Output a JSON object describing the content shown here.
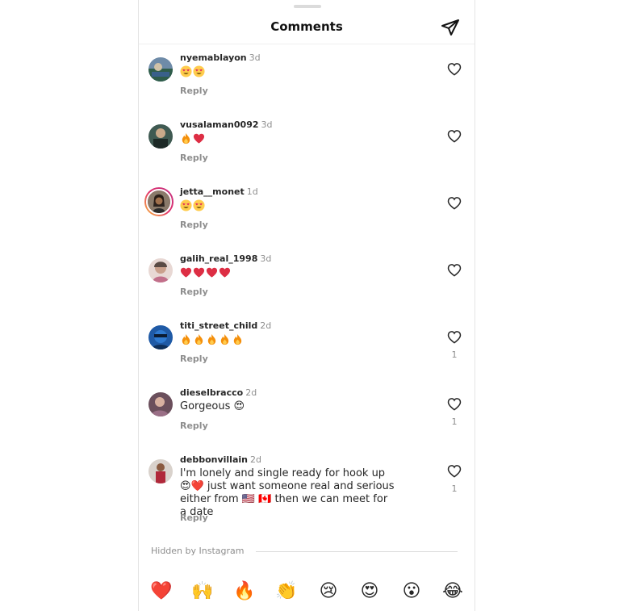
{
  "header": {
    "title": "Comments",
    "share_icon": "paper-plane-icon"
  },
  "comments": [
    {
      "username": "nyemablayon",
      "time": "3d",
      "emojis": [
        "heart-eyes",
        "heart-eyes"
      ],
      "text": "",
      "reply": "Reply",
      "likes": ""
    },
    {
      "username": "vusalaman0092",
      "time": "3d",
      "emojis": [
        "fire",
        "red-heart"
      ],
      "text": "",
      "reply": "Reply",
      "likes": ""
    },
    {
      "username": "jetta__monet",
      "time": "1d",
      "emojis": [
        "heart-eyes",
        "heart-eyes"
      ],
      "text": "",
      "reply": "Reply",
      "likes": ""
    },
    {
      "username": "galih_real_1998",
      "time": "3d",
      "emojis": [
        "red-heart",
        "red-heart",
        "red-heart",
        "red-heart"
      ],
      "text": "",
      "reply": "Reply",
      "likes": ""
    },
    {
      "username": "titi_street_child",
      "time": "2d",
      "emojis": [
        "fire",
        "fire",
        "fire",
        "fire",
        "fire"
      ],
      "text": "",
      "reply": "Reply",
      "likes": "1"
    },
    {
      "username": "dieselbracco",
      "time": "2d",
      "emojis": [],
      "text": "Gorgeous 😍",
      "reply": "Reply",
      "likes": "1"
    },
    {
      "username": "debbonvillain",
      "time": "2d",
      "emojis": [],
      "text": "I'm lonely and single ready for hook up 😍❤️ just want someone real and serious either from 🇺🇸 🇨🇦 then we can meet for a date",
      "reply": "Reply",
      "likes": "1"
    }
  ],
  "hidden": {
    "label": "Hidden by Instagram"
  },
  "quick_emojis": [
    "❤️",
    "🙌",
    "🔥",
    "👏",
    "😢",
    "😍",
    "😮",
    "😂"
  ],
  "colors": {
    "heart_red": "#ed4956",
    "text": "#262626",
    "muted": "#8e8e8e",
    "divider": "#dbdbdb"
  }
}
